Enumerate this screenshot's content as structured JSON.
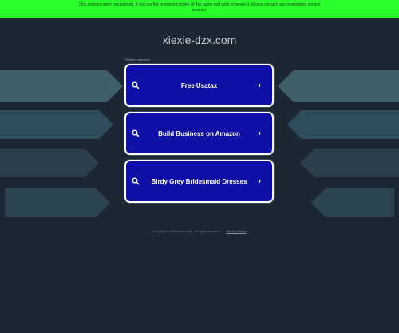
{
  "banner": {
    "line1": "This domain name has expired. If you are the registered holder of this name and wish to renew it, please contact your registration service",
    "line2": "provider."
  },
  "domain_title": "xiexie-dzx.com",
  "related_label": "Related searches",
  "cards": [
    {
      "label": "Free Usatax"
    },
    {
      "label": "Build Business on Amazon"
    },
    {
      "label": "Birdy Grey Bridesmaid Dresses"
    }
  ],
  "footer": {
    "copyright": "Copyright © xiexie-dzx.com . All rights reserved.",
    "privacy": "Privacy Policy"
  },
  "colors": {
    "background": "#1c2733",
    "banner": "#2bff2b",
    "card": "#1010a6",
    "deco_left": "#3f5a66",
    "deco_right": "#3f5a66"
  }
}
